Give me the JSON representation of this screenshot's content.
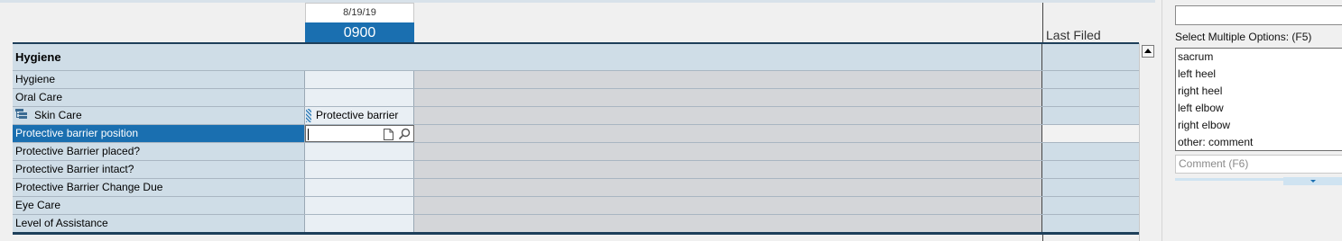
{
  "header": {
    "date": "8/19/19",
    "time": "0900",
    "last_filed_label": "Last Filed"
  },
  "section": {
    "title": "Hygiene"
  },
  "rows": [
    {
      "label": "Hygiene",
      "value": ""
    },
    {
      "label": "Oral Care",
      "value": ""
    },
    {
      "label": "Skin Care",
      "value": "Protective barrier",
      "icon": "tree-expand-icon"
    },
    {
      "label": "Protective barrier position",
      "value": "",
      "selected": true
    },
    {
      "label": "Protective Barrier placed?",
      "value": ""
    },
    {
      "label": "Protective Barrier intact?",
      "value": ""
    },
    {
      "label": "Protective Barrier Change Due",
      "value": ""
    },
    {
      "label": "Eye Care",
      "value": ""
    },
    {
      "label": "Level of Assistance",
      "value": ""
    }
  ],
  "right_panel": {
    "search_value": "",
    "multi_select_label": "Select Multiple Options: (F5)",
    "options": [
      "sacrum",
      "left heel",
      "right heel",
      "left elbow",
      "right elbow",
      "other: comment"
    ],
    "comment_placeholder": "Comment (F6)"
  },
  "colors": {
    "accent_blue": "#1a6fb0",
    "row_bg": "#cfdde7",
    "gray_area": "#d4d6d9"
  }
}
